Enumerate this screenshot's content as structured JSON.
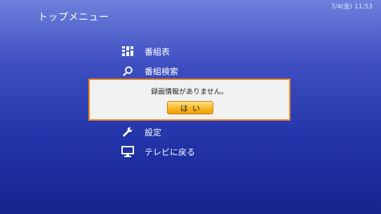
{
  "header": {
    "title": "トップメニュー",
    "datetime": "7/4(金)  11:53"
  },
  "menu": {
    "items": [
      {
        "label": "番組表",
        "icon": "grid-icon"
      },
      {
        "label": "番組検索",
        "icon": "search-icon"
      },
      {
        "label": "設定",
        "icon": "wrench-icon"
      },
      {
        "label": "テレビに戻る",
        "icon": "tv-icon"
      }
    ]
  },
  "dialog": {
    "message": "録画情報がありません。",
    "button_label": "はい"
  },
  "colors": {
    "accent": "#f08a1c",
    "button": "#f7b923",
    "background_top": "#6e7fdc",
    "background_bottom": "#16248f"
  }
}
